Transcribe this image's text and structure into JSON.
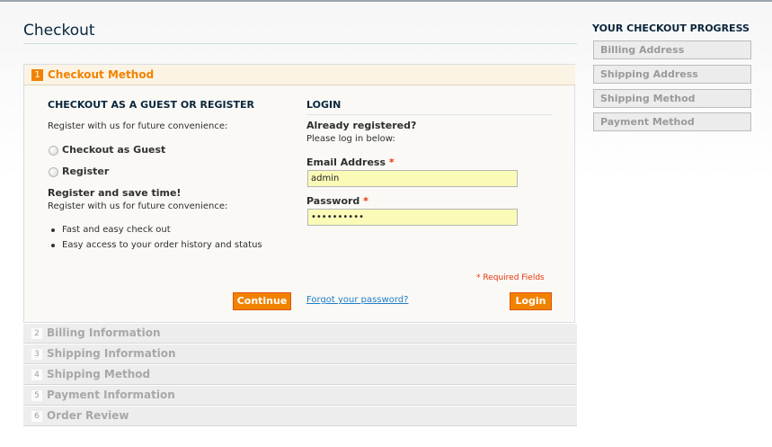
{
  "page": {
    "title": "Checkout"
  },
  "active_step": {
    "number": "1",
    "title": "Checkout Method"
  },
  "guest": {
    "heading": "CHECKOUT AS A GUEST OR REGISTER",
    "intro": "Register with us for future convenience:",
    "options": [
      {
        "label": "Checkout as Guest"
      },
      {
        "label": "Register"
      }
    ],
    "save_heading": "Register and save time!",
    "save_intro": "Register with us for future convenience:",
    "benefits": [
      "Fast and easy check out",
      "Easy access to your order history and status"
    ],
    "continue_label": "Continue"
  },
  "login": {
    "heading": "LOGIN",
    "already": "Already registered?",
    "please": "Please log in below:",
    "email_label": "Email Address",
    "email_value": "admin",
    "password_label": "Password",
    "password_value": "••••••••••",
    "required_star": "*",
    "required_note": "* Required Fields",
    "forgot_label": "Forgot your password?",
    "login_label": "Login"
  },
  "steps": [
    {
      "number": "2",
      "label": "Billing Information"
    },
    {
      "number": "3",
      "label": "Shipping Information"
    },
    {
      "number": "4",
      "label": "Shipping Method"
    },
    {
      "number": "5",
      "label": "Payment Information"
    },
    {
      "number": "6",
      "label": "Order Review"
    }
  ],
  "sidebar": {
    "title": "YOUR CHECKOUT PROGRESS",
    "items": [
      {
        "label": "Billing Address"
      },
      {
        "label": "Shipping Address"
      },
      {
        "label": "Shipping Method"
      },
      {
        "label": "Payment Method"
      }
    ]
  },
  "colors": {
    "accent": "#f18200",
    "link": "#1e7ec8",
    "required": "#eb340a",
    "heading": "#0a263c"
  }
}
